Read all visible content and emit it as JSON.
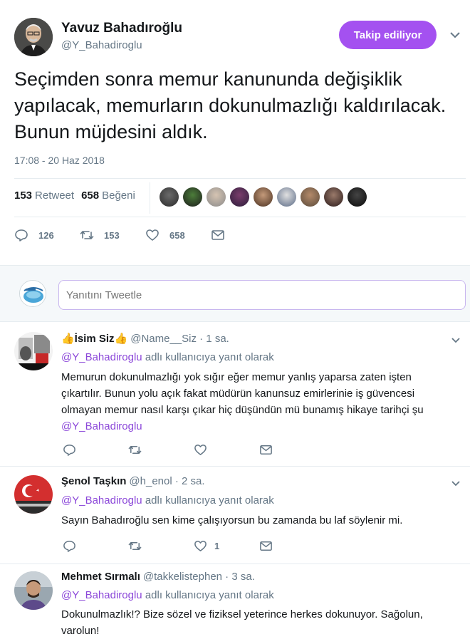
{
  "main_tweet": {
    "author_name": "Yavuz Bahadıroğlu",
    "author_handle": "@Y_Bahadiroglu",
    "follow_label": "Takip ediliyor",
    "text": "Seçimden sonra memur kanununda değişiklik yapılacak, memurların dokunulmazlığı kaldırılacak. Bunun müjdesini aldık.",
    "date": "17:08 - 20 Haz 2018",
    "retweets": "153",
    "retweets_label": "Retweet",
    "likes": "658",
    "likes_label": "Beğeni",
    "action_counts": {
      "replies": "126",
      "retweets": "153",
      "likes": "658"
    }
  },
  "reply_box": {
    "placeholder": "Yanıtını Tweetle"
  },
  "replies": [
    {
      "name": "👍İsim Siz👍",
      "handle": "@Name__Siz · 1 sa.",
      "reply_to_mention": "@Y_Bahadiroglu",
      "reply_to_suffix": "adlı kullanıcıya yanıt olarak",
      "text": "Memurun dokunulmazlığı yok sığır eğer memur yanlış yaparsa zaten işten çıkartılır. Bunun yolu açık fakat müdürün kanunsuz emirlerinie iş güvencesi olmayan memur nasıl karşı çıkar hiç düşündün mü bunamış hikaye tarihçi şu",
      "text_mention": "@Y_Bahadiroglu",
      "like_count": ""
    },
    {
      "name": "Şenol Taşkın",
      "handle": "@h_enol · 2 sa.",
      "reply_to_mention": "@Y_Bahadiroglu",
      "reply_to_suffix": "adlı kullanıcıya yanıt olarak",
      "text": "Sayın Bahadıroğlu sen kime çalışıyorsun bu zamanda bu laf söylenir mi.",
      "text_mention": "",
      "like_count": "1"
    },
    {
      "name": "Mehmet Sırmalı",
      "handle": "@takkelistephen · 3 sa.",
      "reply_to_mention": "@Y_Bahadiroglu",
      "reply_to_suffix": "adlı kullanıcıya yanıt olarak",
      "text": "Dokunulmazlık!? Bize sözel ve fiziksel yeterince herkes dokunuyor. Sağolun, varolun!",
      "text_mention": "",
      "like_count": ""
    }
  ],
  "icons": {
    "reply": "reply-icon",
    "retweet": "retweet-icon",
    "like": "heart-icon",
    "message": "envelope-icon",
    "caret": "chevron-down-icon"
  },
  "colors": {
    "accent": "#a451f0",
    "mention": "#8b47d9",
    "secondary_text": "#657786",
    "border": "#e6ecf0"
  }
}
